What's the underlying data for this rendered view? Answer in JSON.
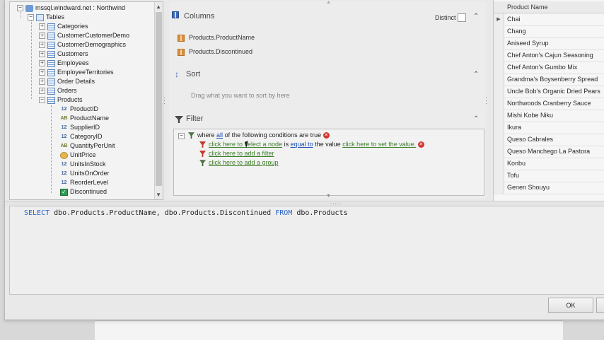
{
  "tree": {
    "root": "mssql.windward.net : Northwind",
    "tables_label": "Tables",
    "tables": [
      "Categories",
      "CustomerCustomerDemo",
      "CustomerDemographics",
      "Customers",
      "Employees",
      "EmployeeTerritories",
      "Order Details",
      "Orders",
      "Products"
    ],
    "columns": [
      {
        "label": "ProductID",
        "icon": "numeric-column-icon",
        "badge": "12"
      },
      {
        "label": "ProductName",
        "icon": "text-column-icon",
        "badge": "AB"
      },
      {
        "label": "SupplierID",
        "icon": "numeric-column-icon",
        "badge": "12"
      },
      {
        "label": "CategoryID",
        "icon": "numeric-column-icon",
        "badge": "12"
      },
      {
        "label": "QuantityPerUnit",
        "icon": "text-column-icon",
        "badge": "AB"
      },
      {
        "label": "UnitPrice",
        "icon": "money-column-icon",
        "badge": ""
      },
      {
        "label": "UnitsInStock",
        "icon": "numeric-column-icon",
        "badge": "12"
      },
      {
        "label": "UnitsOnOrder",
        "icon": "numeric-column-icon",
        "badge": "12"
      },
      {
        "label": "ReorderLevel",
        "icon": "numeric-column-icon",
        "badge": "12"
      },
      {
        "label": "Discontinued",
        "icon": "boolean-column-icon",
        "badge": "✓"
      }
    ]
  },
  "columns_section": {
    "title": "Columns",
    "distinct_label": "Distinct",
    "items": [
      "Products.ProductName",
      "Products.Discontinued"
    ]
  },
  "sort_section": {
    "title": "Sort",
    "hint": "Drag what you want to sort by here"
  },
  "filter_section": {
    "title": "Filter",
    "where": "where",
    "all": "all",
    "cond_suffix": "of the following conditions are true",
    "select_node": "click here to select a node",
    "is": "is",
    "equal_to": "equal to",
    "the_value": "the value",
    "set_value": "click here to set the value.",
    "add_filter": "click here to add a filter",
    "add_group": "click here to add a group"
  },
  "grid": {
    "header": "Product Name",
    "rows": [
      "Chai",
      "Chang",
      "Aniseed Syrup",
      "Chef Anton's Cajun Seasoning",
      "Chef Anton's Gumbo Mix",
      "Grandma's Boysenberry Spread",
      "Uncle Bob's Organic Dried Pears",
      "Northwoods Cranberry Sauce",
      "Mishi Kobe Niku",
      "Ikura",
      "Queso Cabrales",
      "Queso Manchego La Pastora",
      "Konbu",
      "Tofu",
      "Genen Shouyu"
    ]
  },
  "sql": {
    "kw_select": "SELECT",
    "cols": " dbo.Products.ProductName, dbo.Products.Discontinued ",
    "kw_from": "FROM",
    "table": " dbo.Products"
  },
  "buttons": {
    "ok": "OK"
  },
  "colors": {
    "keyword": "#2a63c7",
    "link_green": "#3d7f2b",
    "link_blue": "#1f4fb4",
    "delete_red": "#d0352f"
  }
}
